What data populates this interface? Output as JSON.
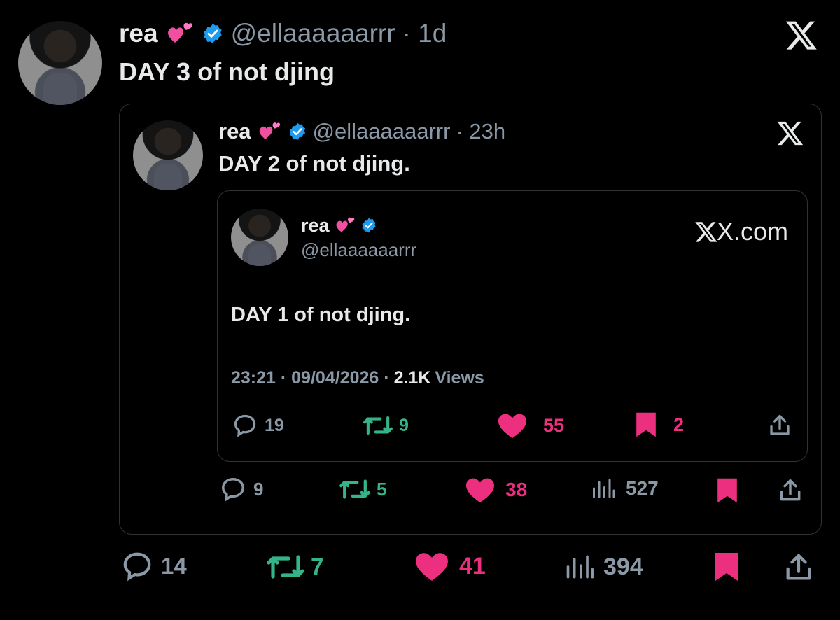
{
  "outer": {
    "name": "rea",
    "handle": "@ellaaaaaarrr",
    "time": "· 1d",
    "text": "DAY 3 of not djing",
    "stats": {
      "replies": "14",
      "reposts": "7",
      "likes": "41",
      "views": "394"
    }
  },
  "quote1": {
    "name": "rea",
    "handle": "@ellaaaaaarrr",
    "time": "· 23h",
    "text": "DAY 2 of not djing.",
    "stats": {
      "replies": "9",
      "reposts": "5",
      "likes": "38",
      "views": "527"
    }
  },
  "quote2": {
    "name": "rea",
    "handle": "@ellaaaaaarrr",
    "site": "X.com",
    "text": "DAY 1 of not djing.",
    "timestamp": "23:21 · 09/04/2026 ·",
    "views_count": "2.1K",
    "views_label": "Views",
    "stats": {
      "replies": "19",
      "reposts": "9",
      "likes": "55",
      "bookmarks": "2"
    }
  },
  "colors": {
    "verified": "#1d9bf0",
    "like": "#ed2f7f",
    "repost": "#35b48b",
    "muted": "#8b98a5",
    "border": "#2f3336"
  },
  "icons": [
    "x-logo-icon",
    "verified-badge-icon",
    "two-hearts-emoji",
    "reply-icon",
    "repost-icon",
    "like-icon",
    "views-icon",
    "bookmark-icon",
    "share-icon"
  ]
}
